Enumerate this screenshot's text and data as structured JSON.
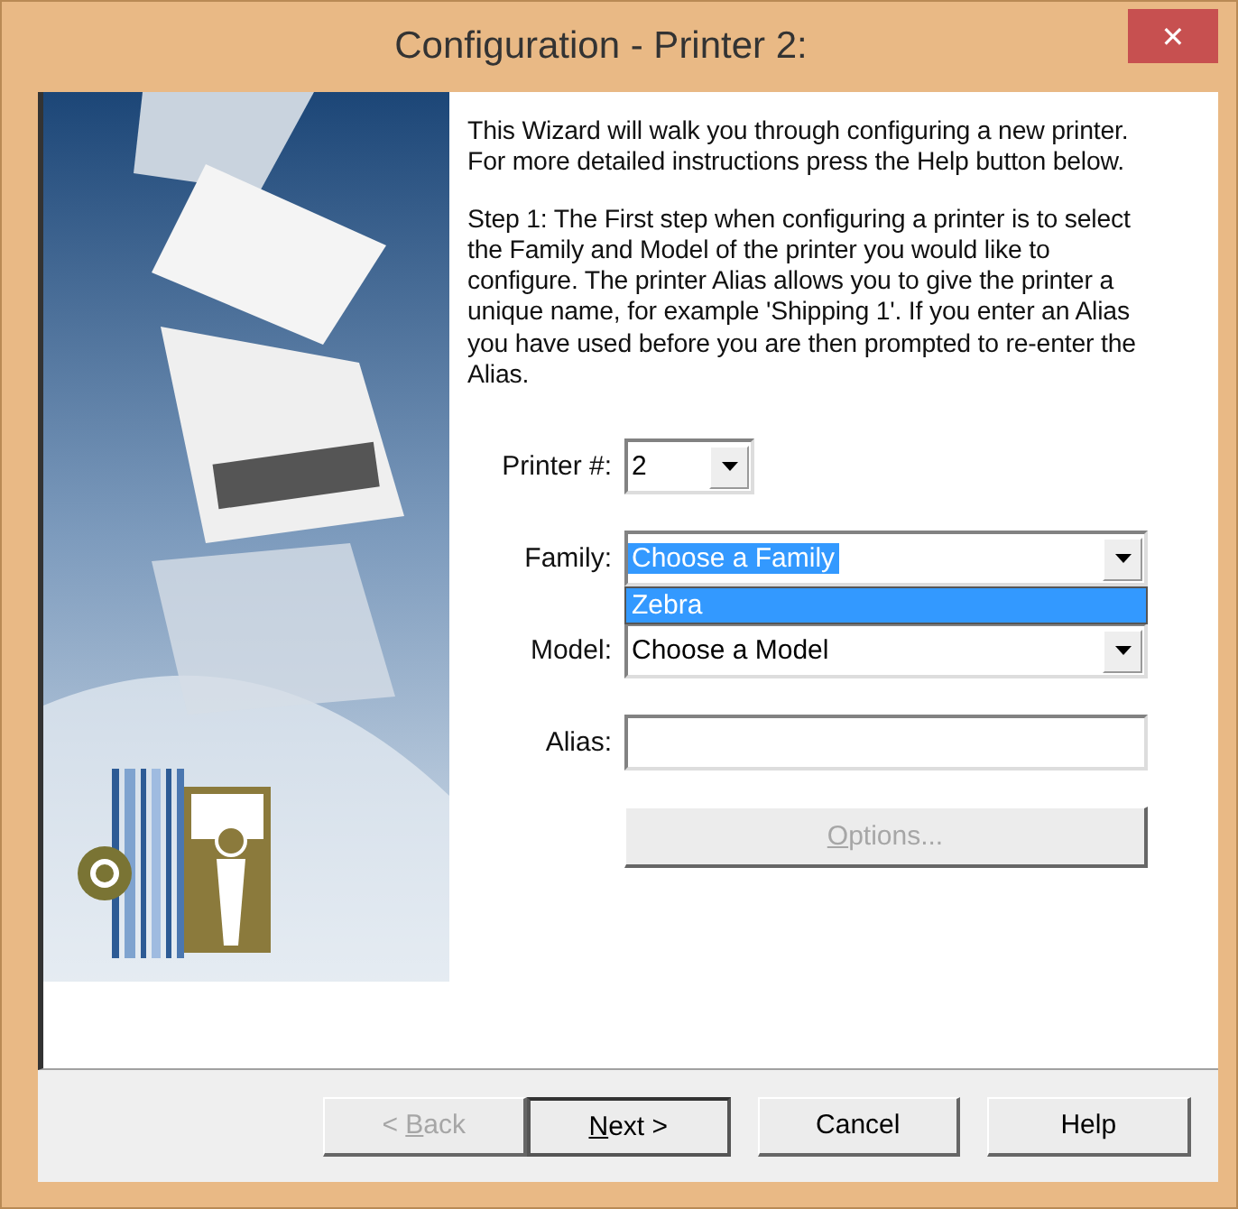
{
  "window": {
    "title": "Configuration - Printer 2:",
    "close": "✕"
  },
  "intro": "This Wizard will walk you through configuring a new printer. For more detailed instructions press the Help button below.",
  "step": "Step 1:  The First step when configuring a printer is to select the Family and Model of the printer you would like to configure. The printer Alias allows you to give the printer a unique name, for example 'Shipping 1'. If you enter an Alias you have used before you are then prompted to re-enter the Alias.",
  "form": {
    "printer": {
      "label": "Printer #:",
      "value": "2"
    },
    "family": {
      "label": "Family:",
      "value": "Choose a Family",
      "text_selected": true,
      "expanded": true,
      "options": [
        {
          "label": "Zebra",
          "selected": true
        }
      ]
    },
    "model": {
      "label": "Model:",
      "value": "Choose a Model"
    },
    "alias": {
      "label": "Alias:"
    },
    "options_button": {
      "access_key": "O",
      "after": "ptions...",
      "disabled": true
    }
  },
  "buttons": [
    {
      "before": "< ",
      "access_key": "B",
      "after": "ack",
      "disabled": true,
      "default": false
    },
    {
      "access_key": "N",
      "after": "ext >",
      "disabled": false,
      "default": true
    },
    {
      "before": "Cancel",
      "disabled": false,
      "default": false
    },
    {
      "before": "Help",
      "disabled": false,
      "default": false
    }
  ]
}
